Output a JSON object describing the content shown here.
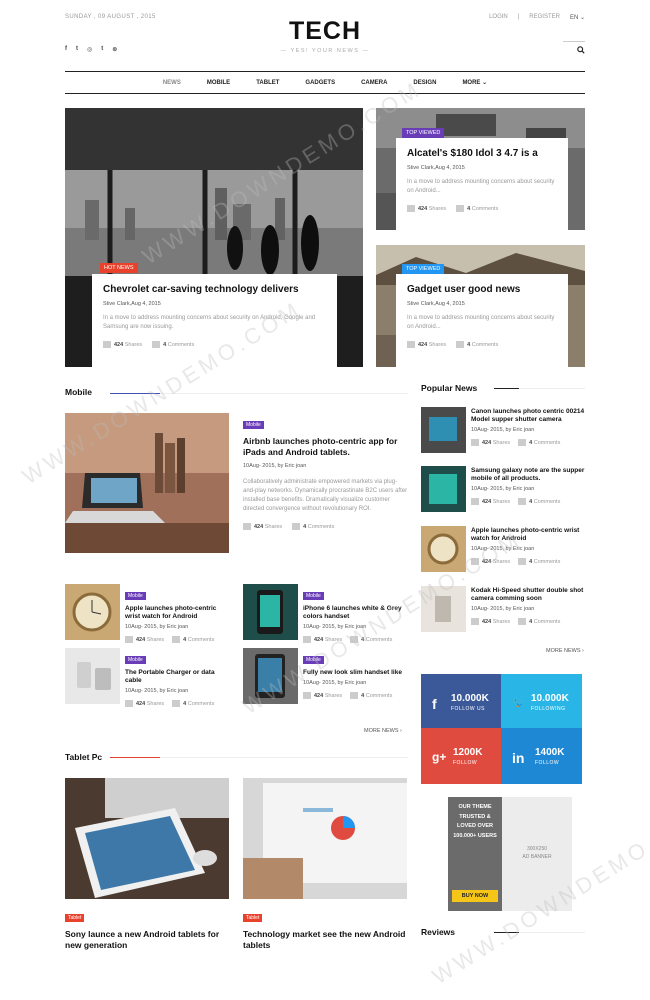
{
  "header": {
    "date": "SUNDAY , 09 AUGUST , 2015",
    "logo": "TECH",
    "tagline": "— YES! YOUR NEWS —",
    "login": "LOGIN",
    "sep": "|",
    "register": "REGISTER",
    "lang": "EN ⌄",
    "socials": [
      "f",
      "t",
      "◎",
      "t",
      "⊛"
    ]
  },
  "nav": {
    "items": [
      "NEWS",
      "MOBILE",
      "TABLET",
      "GADGETS",
      "CAMERA",
      "DESIGN",
      "MORE ⌄"
    ]
  },
  "hero": {
    "main": {
      "tag": "HOT NEWS",
      "title": "Chevrolet car-saving technology delivers",
      "meta": "Stive Clark,Aug 4, 2015",
      "excerpt": "In a move to address mounting concerns about security on Android, Google and Samsung are now issuing.",
      "shares": "424",
      "shares_label": "Shares",
      "comments": "4",
      "comments_label": "Comments"
    },
    "side1": {
      "tag": "TOP VIEWED",
      "title": "Alcatel's $180 Idol 3 4.7 is a",
      "meta": "Stive Clark,Aug 4, 2015",
      "excerpt": "In a move to address mounting concerns about security on Android...",
      "shares": "424",
      "shares_label": "Shares",
      "comments": "4",
      "comments_label": "Comments"
    },
    "side2": {
      "tag": "TOP VIEWED",
      "title": "Gadget user good news",
      "meta": "Stive Clark,Aug 4, 2015",
      "excerpt": "In a move to address mounting concerns about security on Android...",
      "shares": "424",
      "shares_label": "Shares",
      "comments": "4",
      "comments_label": "Comments"
    }
  },
  "mobile": {
    "heading": "Mobile",
    "feature": {
      "pill": "Mobile",
      "title": "Airbnb launches photo-centric app for iPads and Android tablets.",
      "meta": "10Aug- 2015, by Eric joan",
      "excerpt": "Collaboratively administrate empowered markets via plug-and-play networks. Dynamically procrastinate B2C users after installed base benefits. Dramatically visualize customer directed convergence without revolutionary ROI.",
      "shares": "424",
      "shares_label": "Shares",
      "comments": "4",
      "comments_label": "Comments"
    },
    "small": [
      {
        "pill": "Mobile",
        "title": "Apple launches photo-centric wrist watch for Android",
        "meta": "10Aug- 2015, by Eric joan",
        "shares": "424",
        "shares_label": "Shares",
        "comments": "4",
        "comments_label": "Comments"
      },
      {
        "pill": "Mobile",
        "title": "iPhone 6 launches white & Grey colors handset",
        "meta": "10Aug- 2015, by Eric joan",
        "shares": "424",
        "shares_label": "Shares",
        "comments": "4",
        "comments_label": "Comments"
      },
      {
        "pill": "Mobile",
        "title": "The Portable Charger or data cable",
        "meta": "10Aug- 2015, by Eric joan",
        "shares": "424",
        "shares_label": "Shares",
        "comments": "4",
        "comments_label": "Comments"
      },
      {
        "pill": "Mobile",
        "title": "Fully new look slim handset like",
        "meta": "10Aug- 2015, by Eric joan",
        "shares": "424",
        "shares_label": "Shares",
        "comments": "4",
        "comments_label": "Comments"
      }
    ],
    "more": "MORE NEWS ›"
  },
  "tablet": {
    "heading": "Tablet Pc",
    "items": [
      {
        "pill": "Tablet",
        "title": "Sony launce a new Android tablets for new generation"
      },
      {
        "pill": "Tablet",
        "title": "Technology market see the new Android tablets"
      }
    ]
  },
  "popular": {
    "heading": "Popular News",
    "items": [
      {
        "title": "Canon launches photo centric 00214 Model supper shutter camera",
        "meta": "10Aug- 2015, by Eric joan",
        "shares": "424",
        "shares_label": "Shares",
        "comments": "4",
        "comments_label": "Comments"
      },
      {
        "title": "Samsung galaxy note are the supper mobile of all products.",
        "meta": "10Aug- 2015, by Eric joan",
        "shares": "424",
        "shares_label": "Shares",
        "comments": "4",
        "comments_label": "Comments"
      },
      {
        "title": "Apple launches photo-centric wrist watch for Android",
        "meta": "10Aug- 2015, by Eric joan",
        "shares": "424",
        "shares_label": "Shares",
        "comments": "4",
        "comments_label": "Comments"
      },
      {
        "title": "Kodak Hi-Speed shutter double shot camera comming soon",
        "meta": "10Aug- 2015, by Eric joan",
        "shares": "424",
        "shares_label": "Shares",
        "comments": "4",
        "comments_label": "Comments"
      }
    ],
    "more": "MORE NEWS ›"
  },
  "social": [
    {
      "icon": "f",
      "count": "10.000K",
      "label": "FOLLOW US",
      "color": "#3b5998"
    },
    {
      "icon": "🐦",
      "count": "10.000K",
      "label": "FOLLOWING",
      "color": "#29b6e6"
    },
    {
      "icon": "g+",
      "count": "1200K",
      "label": "FOLLOW",
      "color": "#e04b3f"
    },
    {
      "icon": "in",
      "count": "1400K",
      "label": "FOLLOW",
      "color": "#1e88d4"
    }
  ],
  "ad": {
    "headline": "OUR THEME TRUSTED & LOVED OVER 100.000+ USERS",
    "button": "BUY NOW",
    "size": "300X250",
    "label": "AD BANNER"
  },
  "reviews": {
    "heading": "Reviews"
  },
  "colors": {
    "hot": "#e8412c",
    "top": "#6a3db8",
    "top2": "#2196f3",
    "accent_line": "#3f51b5",
    "tablet_line": "#e8412c",
    "yellow": "#f5c518"
  }
}
